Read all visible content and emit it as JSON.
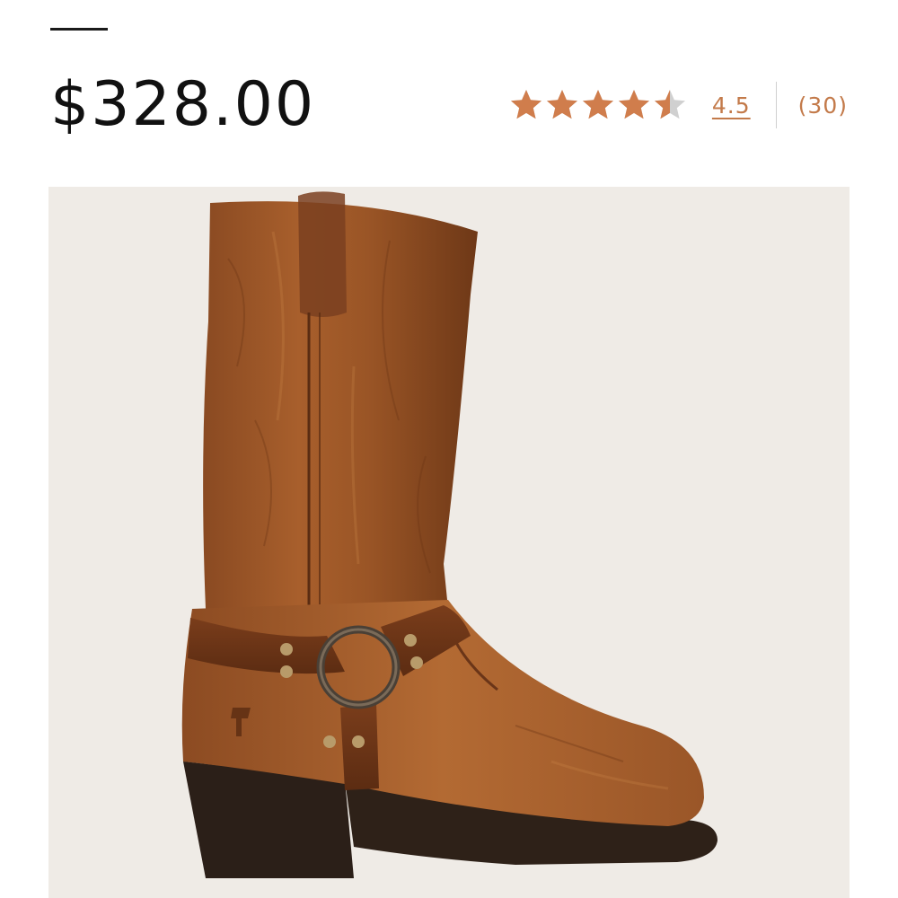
{
  "product": {
    "price": "$328.00",
    "rating": {
      "value": 4.5,
      "value_label": "4.5",
      "max": 5,
      "count_label": "(30)",
      "star_color": "#d07d4c",
      "empty_star_color": "#d0d0d0"
    },
    "image": {
      "subject": "brown leather harness boot",
      "background_color": "#efebe6"
    }
  }
}
